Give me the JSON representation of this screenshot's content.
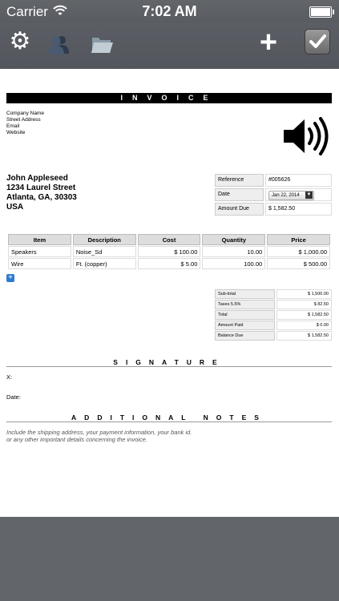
{
  "status": {
    "carrier": "Carrier",
    "time": "7:02 AM"
  },
  "toolbar": {
    "icons": [
      "gear-icon",
      "users-icon",
      "folder-icon",
      "plus-icon",
      "checkmark-icon"
    ]
  },
  "invoice": {
    "title": "INVOICE",
    "company": {
      "name": "Company Name",
      "street": "Street Address",
      "email": "Email",
      "website": "Website"
    },
    "client": {
      "name": "John Appleseed",
      "street": "1234 Laurel Street",
      "city": "Atlanta, GA, 30303",
      "country": "USA"
    },
    "meta": {
      "reference_label": "Reference",
      "reference": "#005626",
      "date_label": "Date",
      "date": "Jan 22, 2014",
      "amount_due_label": "Amount Due",
      "amount_due": "$ 1,582.50"
    },
    "table": {
      "headers": [
        "Item",
        "Description",
        "Cost",
        "Quantity",
        "Price"
      ],
      "rows": [
        [
          "Speakers",
          "Noise_Sd",
          "$ 100.00",
          "10.00",
          "$ 1,000.00"
        ],
        [
          "Wire",
          "Ft. (copper)",
          "$ 5.00",
          "100.00",
          "$ 500.00"
        ]
      ]
    },
    "add_button": "+",
    "totals": [
      {
        "label": "Sub-total",
        "value": "$ 1,500.00"
      },
      {
        "label": "Taxes 5.5%",
        "value": "$ 82.50"
      },
      {
        "label": "Total",
        "value": "$ 1,582.50"
      },
      {
        "label": "Amount Paid",
        "value": "$ 0.00"
      },
      {
        "label": "Balance Due",
        "value": "$ 1,582.50"
      }
    ],
    "signature_title": "SIGNATURE",
    "sig_x": "X:",
    "sig_date": "Date:",
    "notes_title": "ADDITIONAL NOTES",
    "notes_line1": "Include the shipping address, your payment information, your bank id.",
    "notes_line2": "or any other important details concerning the invoice."
  }
}
